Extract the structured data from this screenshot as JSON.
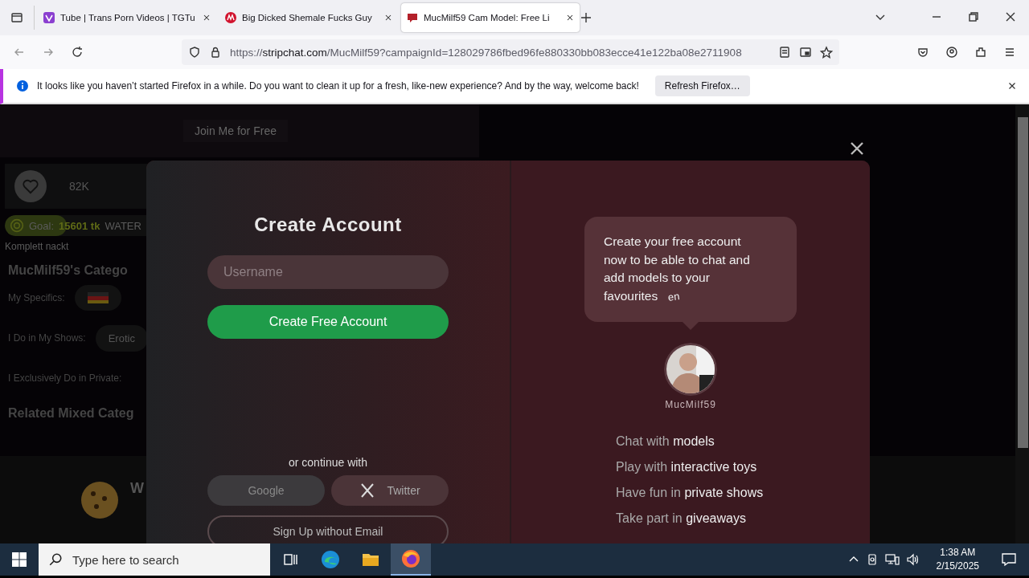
{
  "browser": {
    "tabs": [
      {
        "title": "Tube | Trans Porn Videos | TGTu",
        "selected": false
      },
      {
        "title": "Big Dicked Shemale Fucks Guy",
        "selected": false
      },
      {
        "title": "MucMilf59 Cam Model: Free Li",
        "selected": true
      }
    ],
    "address": {
      "scheme": "https://",
      "host": "stripchat.com",
      "path": "/MucMilf59?campaignId=128029786fbed96fe880330bb083ecce41e122ba08e2711908"
    },
    "notification": {
      "message": "It looks like you haven’t started Firefox in a while. Do you want to clean it up for a fresh, like-new experience? And by the way, welcome back!",
      "button": "Refresh Firefox…"
    }
  },
  "page": {
    "join_label": "Join Me for Free",
    "likes": "82K",
    "goal": {
      "label": "Goal:",
      "amount": "15601 tk",
      "name": "WATER",
      "level": 0.18
    },
    "goal_note": "Komplett nackt",
    "categories_title": "MucMilf59's Catego",
    "rows": [
      {
        "label": "My Specifics:"
      },
      {
        "label": "I Do in My Shows:",
        "tag": "Erotic"
      },
      {
        "label": "I Exclusively Do in Private:"
      }
    ],
    "related_title": "Related Mixed Categ",
    "cookie_letter": "W"
  },
  "modal": {
    "title": "Create Account",
    "username_placeholder": "Username",
    "create_button": "Create Free Account",
    "continue_label": "or continue with",
    "social": [
      {
        "label": "Google"
      },
      {
        "label": "Twitter"
      }
    ],
    "no_email_button": "Sign Up without Email",
    "bubble": {
      "text": "Create your free account now to be able to chat and add models to your favourites",
      "mark": "en"
    },
    "model_name": "MucMilf59",
    "features": [
      {
        "lead": "Chat with",
        "emphasis": "models"
      },
      {
        "lead": "Play with",
        "emphasis": "interactive toys"
      },
      {
        "lead": "Have fun in",
        "emphasis": "private shows"
      },
      {
        "lead": "Take part in",
        "emphasis": "giveaways"
      }
    ]
  },
  "taskbar": {
    "search_placeholder": "Type here to search",
    "time": "1:38 AM",
    "date": "2/15/2025"
  }
}
